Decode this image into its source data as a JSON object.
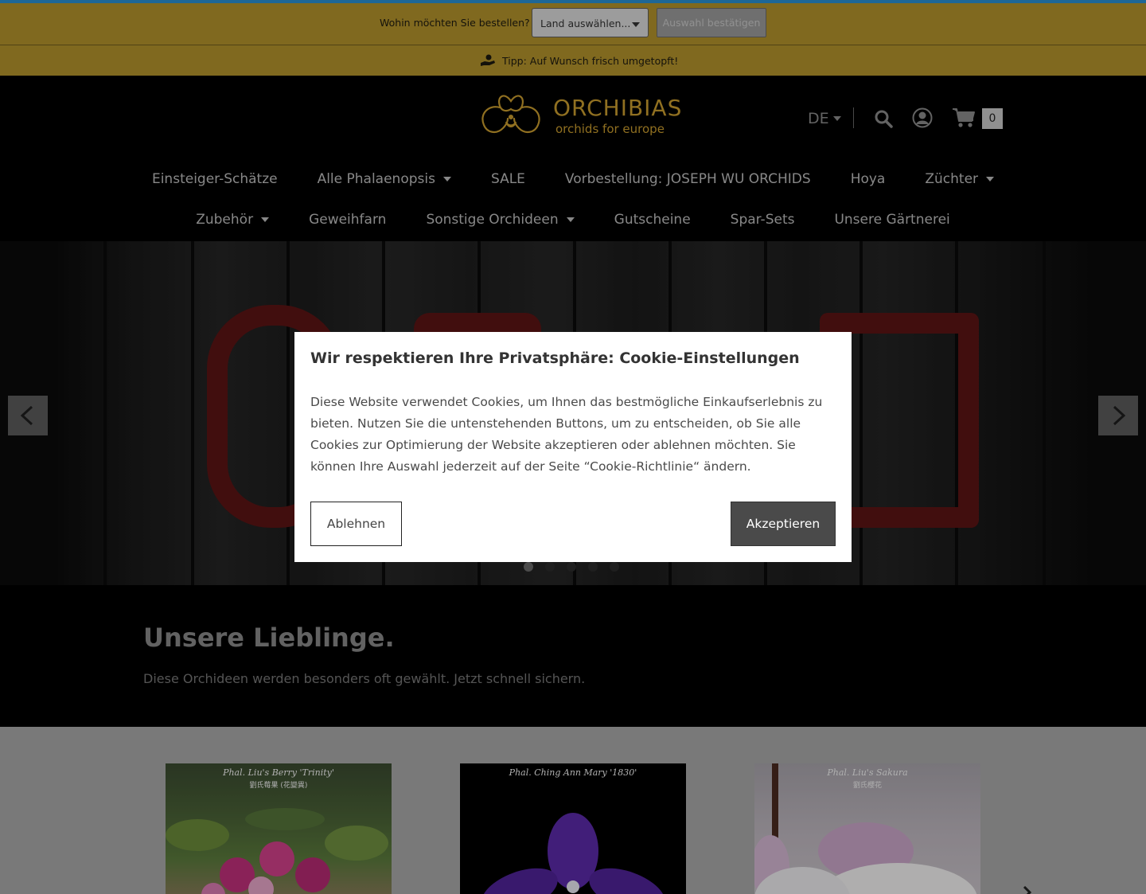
{
  "country_bar": {
    "question": "Wohin möchten Sie bestellen?",
    "select_value": "Land auswählen...",
    "confirm_label": "Auswahl bestätigen"
  },
  "tip_bar": {
    "text": "Tipp: Auf Wunsch frisch umgetopft!"
  },
  "header": {
    "logo": {
      "brand": "ORCHIBIAS",
      "tagline": "orchids for europe"
    },
    "language": "DE",
    "cart_count": "0"
  },
  "nav": {
    "row1": [
      {
        "label": "Einsteiger-Schätze",
        "dropdown": false
      },
      {
        "label": "Alle Phalaenopsis",
        "dropdown": true
      },
      {
        "label": "SALE",
        "dropdown": false
      },
      {
        "label": "Vorbestellung: JOSEPH WU ORCHIDS",
        "dropdown": false
      },
      {
        "label": "Hoya",
        "dropdown": false
      },
      {
        "label": "Züchter",
        "dropdown": true
      }
    ],
    "row2": [
      {
        "label": "Zubehör",
        "dropdown": true
      },
      {
        "label": "Geweihfarn",
        "dropdown": false
      },
      {
        "label": "Sonstige Orchideen",
        "dropdown": true
      },
      {
        "label": "Gutscheine",
        "dropdown": false
      },
      {
        "label": "Spar-Sets",
        "dropdown": false
      },
      {
        "label": "Unsere Gärtnerei",
        "dropdown": false
      }
    ]
  },
  "hero": {
    "slides_total": 5,
    "active_slide": 1
  },
  "favorites": {
    "heading": "Unsere Lieblinge.",
    "subtext": "Diese Orchideen werden besonders oft gewählt. Jetzt schnell sichern."
  },
  "products": [
    {
      "title": "Phal. Liu's Berry 'Trinity'",
      "subtitle": "劉氏莓果 (花變異)"
    },
    {
      "title": "Phal. Ching Ann Mary '1830'",
      "subtitle": ""
    },
    {
      "title": "Phal. Liu's Sakura",
      "subtitle": "劉氏櫻花"
    }
  ],
  "cookie_modal": {
    "title": "Wir respektieren Ihre Privatsphäre: Cookie-Einstellungen",
    "body": "Diese Website verwendet Cookies, um Ihnen das bestmögliche Einkaufserlebnis zu bieten. Nutzen Sie die untenstehenden Buttons, um zu entscheiden, ob Sie alle Cookies zur Optimierung der Website akzeptieren oder ablehnen möchten. Sie können Ihre Auswahl jederzeit auf der Seite “Cookie-Richtlinie“ ändern.",
    "decline_label": "Ablehnen",
    "accept_label": "Akzeptieren"
  },
  "colors": {
    "gold_bar": "#b2922b",
    "top_accent": "#2a8fd0",
    "logo_gold": "#c89b2e",
    "accept_button": "#4a4a4a"
  }
}
